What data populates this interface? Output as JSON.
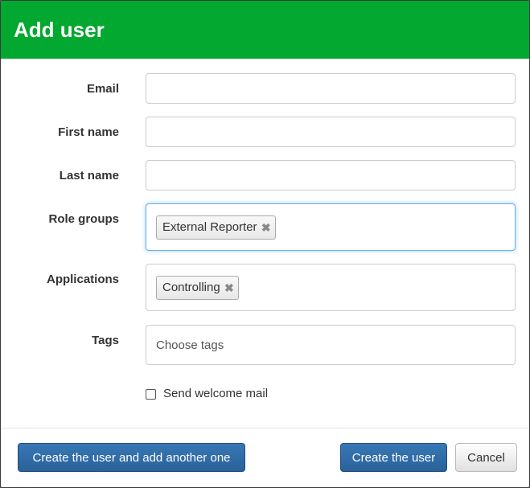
{
  "modal": {
    "title": "Add user"
  },
  "form": {
    "email_label": "Email",
    "email_value": "",
    "first_name_label": "First name",
    "first_name_value": "",
    "last_name_label": "Last name",
    "last_name_value": "",
    "role_groups_label": "Role groups",
    "role_groups_selected": [
      "External Reporter"
    ],
    "applications_label": "Applications",
    "applications_selected": [
      "Controlling"
    ],
    "tags_label": "Tags",
    "tags_placeholder": "Choose tags",
    "welcome_mail_label": "Send welcome mail",
    "welcome_mail_checked": false,
    "remove_glyph": "✖"
  },
  "footer": {
    "create_another_label": "Create the user and add another one",
    "create_label": "Create the user",
    "cancel_label": "Cancel"
  },
  "colors": {
    "header_bg": "#02a82f",
    "primary_btn": "#2f6ca8",
    "focus_border": "#66afe9"
  }
}
